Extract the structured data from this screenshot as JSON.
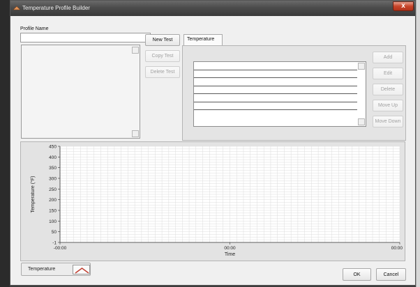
{
  "window": {
    "title": "Temperature Profile Builder",
    "close_label": "x"
  },
  "profile": {
    "label": "Profile Name",
    "name_value": "",
    "new_test_label": "New Test",
    "copy_test_label": "Copy Test",
    "delete_test_label": "Delete Test"
  },
  "tabs": [
    {
      "label": "Temperature",
      "selected": true
    }
  ],
  "steps": {
    "rows": [
      "",
      "",
      "",
      "",
      "",
      "",
      ""
    ],
    "add_label": "Add",
    "edit_label": "Edit",
    "delete_label": "Delete",
    "move_up_label": "Move Up",
    "move_down_label": "Move Down"
  },
  "chart_data": {
    "type": "line",
    "title": "",
    "xlabel": "Time",
    "ylabel": "Temperature (°F)",
    "ylim": [
      -1,
      450
    ],
    "y_ticks": [
      "450",
      "400",
      "350",
      "300",
      "250",
      "200",
      "150",
      "100",
      "50",
      "-1"
    ],
    "x_ticks": [
      "-00:00",
      "00:00",
      "00:00"
    ],
    "grid": true,
    "series": [
      {
        "name": "Temperature",
        "values": []
      }
    ],
    "colors": {
      "series": "#c0392b",
      "grid": "#dcdcdc",
      "plot_bg": "#ffffff"
    }
  },
  "legend": {
    "label": "Temperature",
    "icon": "line-marker-icon"
  },
  "footer": {
    "ok_label": "OK",
    "cancel_label": "Cancel"
  }
}
